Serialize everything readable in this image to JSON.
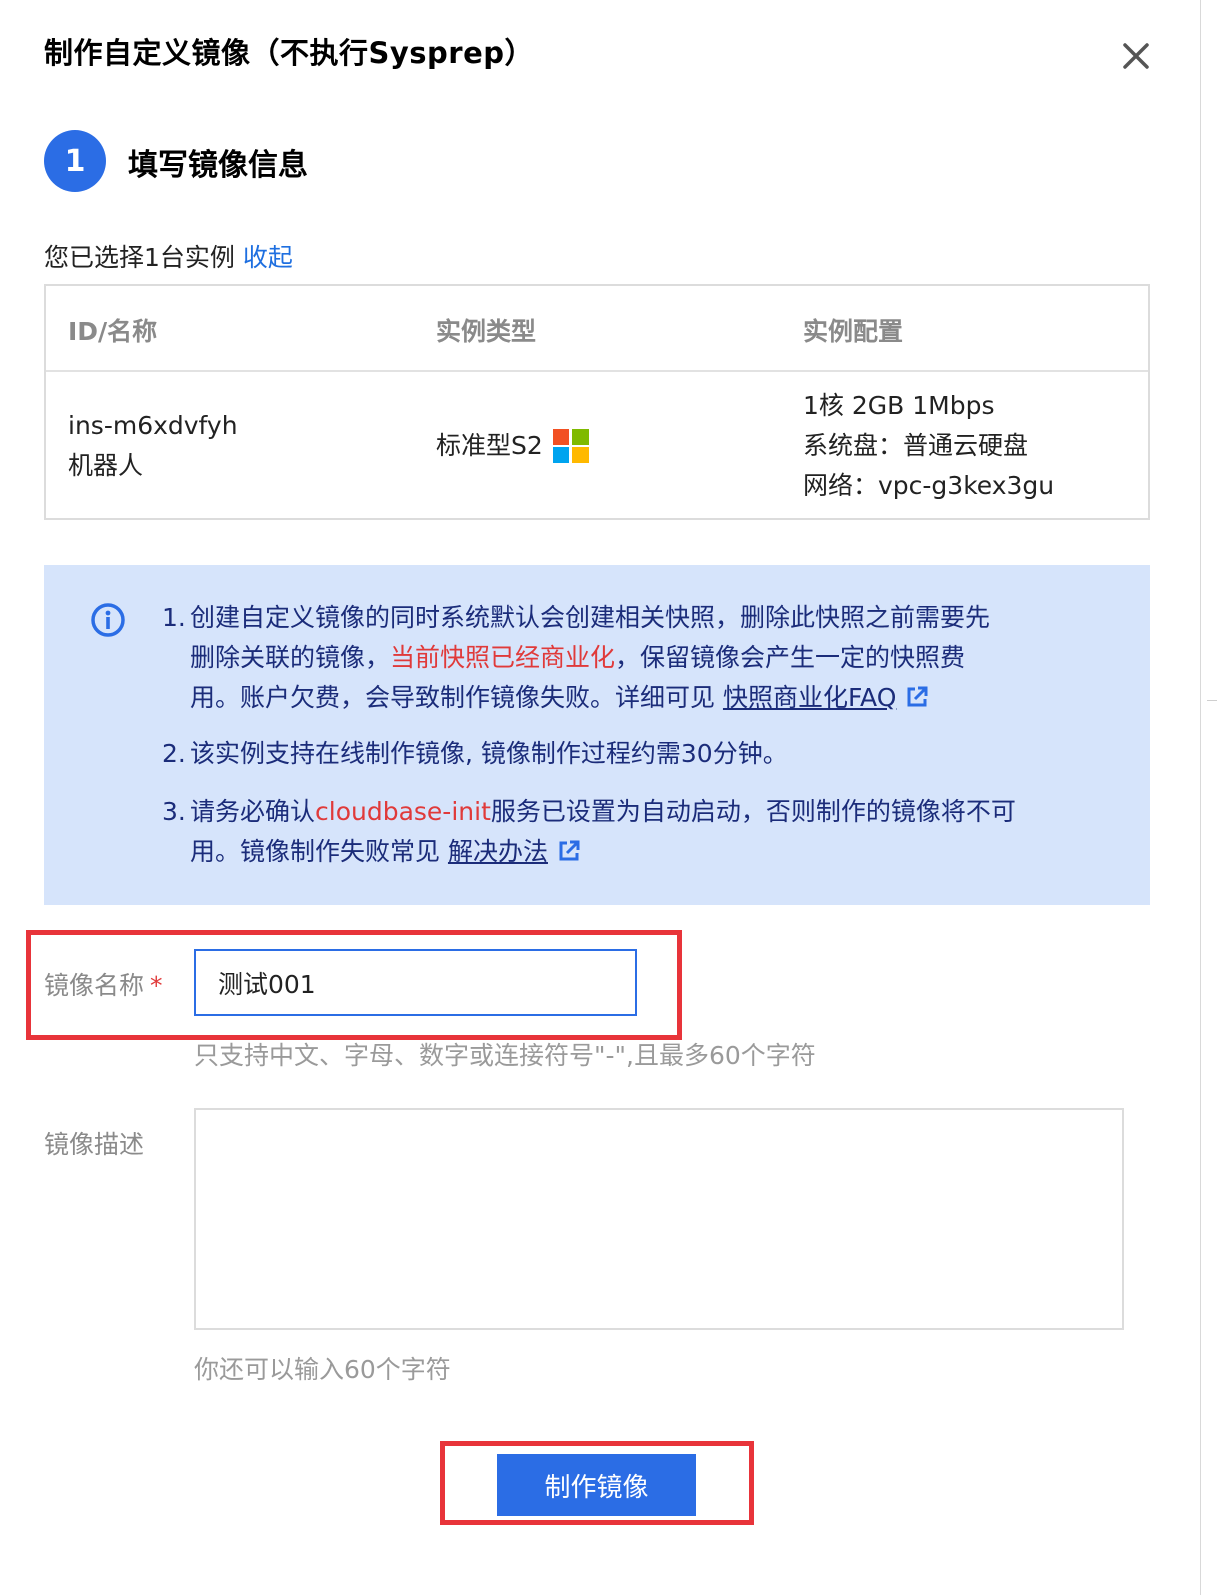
{
  "dialog": {
    "title": "制作自定义镜像（不执行Sysprep）"
  },
  "step": {
    "number": "1",
    "title": "填写镜像信息"
  },
  "selection": {
    "text": "您已选择1台实例",
    "collapse_link": "收起"
  },
  "instance_table": {
    "headers": [
      "ID/名称",
      "实例类型",
      "实例配置"
    ],
    "row": {
      "id": "ins-m6xdvfyh",
      "name": "机器人",
      "type": "标准型S2",
      "os_icon": "windows-icon",
      "config": [
        "1核 2GB 1Mbps",
        "系统盘：普通云硬盘",
        "网络：vpc-g3kex3gu"
      ]
    }
  },
  "notice": {
    "icon": "info-icon",
    "item1": {
      "num": "1.",
      "line1": "创建自定义镜像的同时系统默认会创建相关快照，删除此快照之前需要先",
      "line2_pre": "删除关联的镜像，",
      "line2_red": "当前快照已经商业化",
      "line2_post": "，保留镜像会产生一定的快照费",
      "line3_pre": "用。账户欠费，会导致制作镜像失败。详细可见 ",
      "link": "快照商业化FAQ"
    },
    "item2": {
      "num": "2.",
      "text": "该实例支持在线制作镜像, 镜像制作过程约需30分钟。"
    },
    "item3": {
      "num": "3.",
      "line1_pre": "请务必确认",
      "line1_red": "cloudbase-init",
      "line1_post": "服务已设置为自动启动，否则制作的镜像将不可",
      "line2_pre": "用。镜像制作失败常见 ",
      "link": "解决办法"
    }
  },
  "form": {
    "name_label": "镜像名称",
    "required_mark": "*",
    "name_value": "测试001",
    "name_hint": "只支持中文、字母、数字或连接符号\"-\",且最多60个字符",
    "desc_label": "镜像描述",
    "desc_value": "",
    "desc_hint": "你还可以输入60个字符"
  },
  "actions": {
    "submit_label": "制作镜像"
  },
  "colors": {
    "primary": "#2b6de5",
    "highlight_box": "#e8343a",
    "notice_bg": "#d6e4fb",
    "notice_text": "#1b2c7a",
    "warning_text": "#e03a3a"
  }
}
